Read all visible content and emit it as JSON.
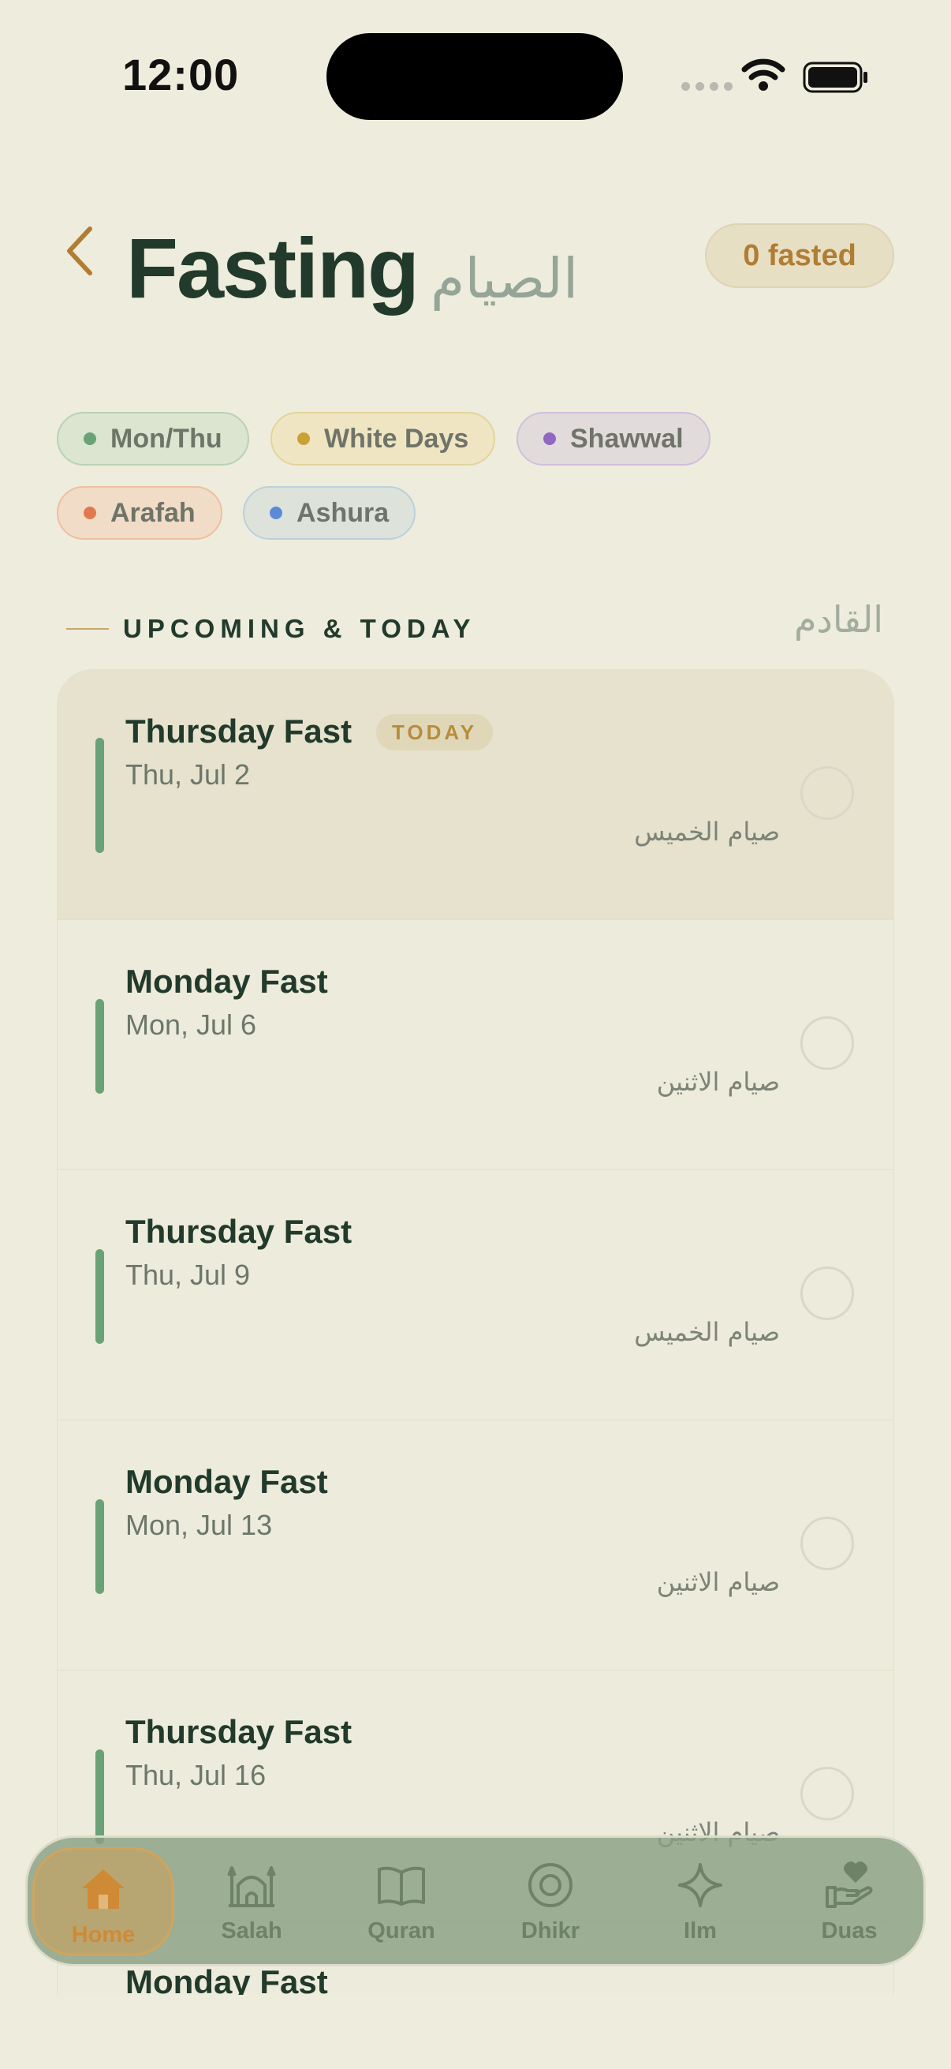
{
  "status": {
    "time": "12:00"
  },
  "header": {
    "title": "Fasting",
    "title_ar": "الصيام",
    "fasted_count": "0 fasted"
  },
  "chips": [
    {
      "label": "Mon/Thu",
      "dot": "#6aa277"
    },
    {
      "label": "White Days",
      "dot": "#c9a233"
    },
    {
      "label": "Shawwal",
      "dot": "#9067c2"
    },
    {
      "label": "Arafah",
      "dot": "#e07a4e"
    },
    {
      "label": "Ashura",
      "dot": "#5b8ad6"
    }
  ],
  "section": {
    "title": "UPCOMING & TODAY",
    "title_ar": "القادم"
  },
  "fasts": [
    {
      "name": "Thursday Fast",
      "badge": "TODAY",
      "date": "Thu, Jul 2",
      "name_ar": "صيام الخميس"
    },
    {
      "name": "Monday Fast",
      "date": "Mon, Jul 6",
      "name_ar": "صيام الاثنين"
    },
    {
      "name": "Thursday Fast",
      "date": "Thu, Jul 9",
      "name_ar": "صيام الخميس"
    },
    {
      "name": "Monday Fast",
      "date": "Mon, Jul 13",
      "name_ar": "صيام الاثنين"
    },
    {
      "name": "Thursday Fast",
      "date": "Thu, Jul 16",
      "name_ar": "صيام الاثنين"
    },
    {
      "name": "Monday Fast"
    }
  ],
  "tabs": [
    {
      "label": "Home",
      "icon": "home-icon",
      "active": true
    },
    {
      "label": "Salah",
      "icon": "mosque-icon"
    },
    {
      "label": "Quran",
      "icon": "book-icon"
    },
    {
      "label": "Dhikr",
      "icon": "ring-icon"
    },
    {
      "label": "Ilm",
      "icon": "sparkle-icon"
    },
    {
      "label": "Duas",
      "icon": "hand-heart-icon"
    }
  ],
  "colors": {
    "accent": "#6aa277",
    "gold": "#b07d34",
    "background": "#eeecdc"
  }
}
